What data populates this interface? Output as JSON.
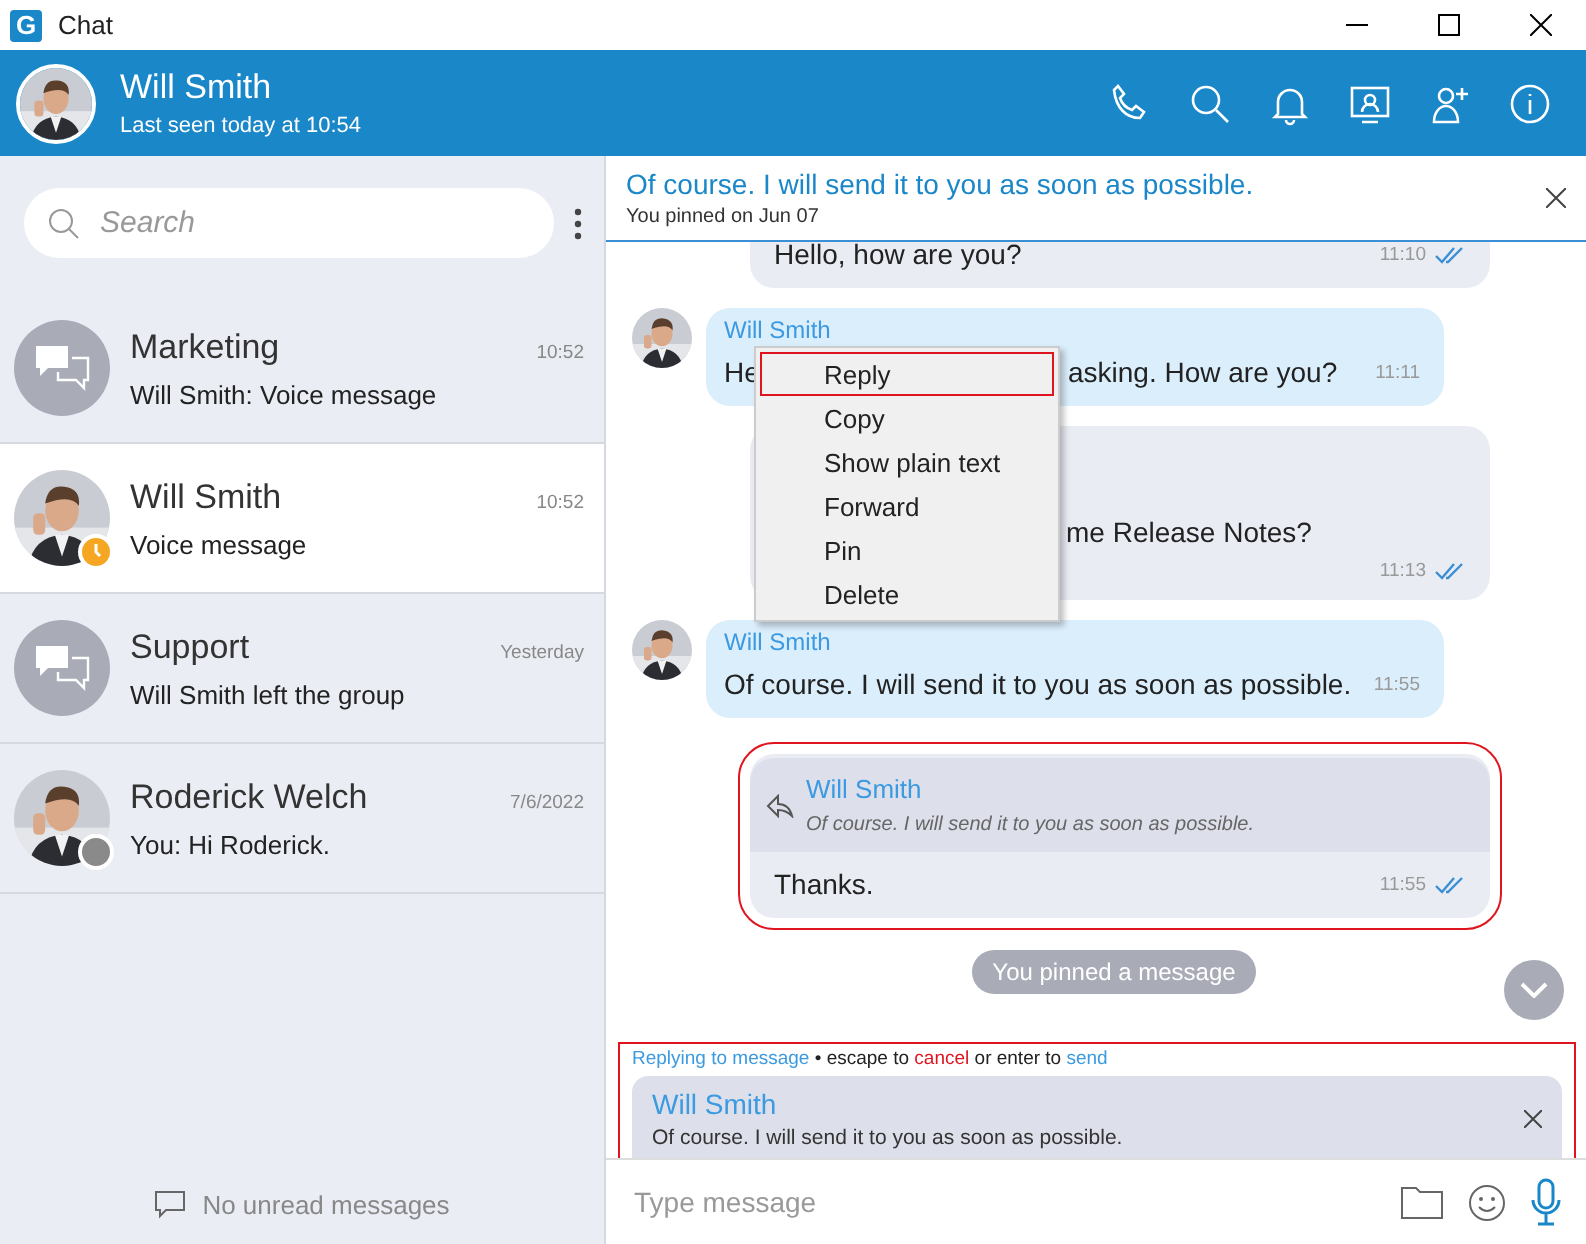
{
  "window": {
    "logo": "G",
    "title": "Chat"
  },
  "header": {
    "name": "Will Smith",
    "status": "Last seen today at 10:54"
  },
  "search": {
    "placeholder": "Search"
  },
  "chats": [
    {
      "kind": "group",
      "name": "Marketing",
      "time": "10:52",
      "preview": "Will Smith: Voice message",
      "selected": false
    },
    {
      "kind": "person",
      "name": "Will Smith",
      "time": "10:52",
      "preview": "Voice message",
      "selected": true,
      "away": true
    },
    {
      "kind": "group",
      "name": "Support",
      "time": "Yesterday",
      "preview": "Will Smith left the group",
      "selected": false
    },
    {
      "kind": "person",
      "name": "Roderick Welch",
      "time": "7/6/2022",
      "preview": "You: Hi Roderick.",
      "selected": false,
      "away": false
    }
  ],
  "sidebar_footer": "No unread messages",
  "pinned": {
    "text": "Of course. I will send it to you as soon as possible.",
    "note": "You pinned on Jun 07"
  },
  "messages": [
    {
      "kind": "outgoing",
      "text": "Hello, how are you?",
      "time": "11:10",
      "read": true,
      "highlighted": false
    },
    {
      "kind": "incoming",
      "sender": "Will Smith",
      "text_head": "He",
      "text_tail": "asking. How are you?",
      "time": "11:11",
      "highlighted": false
    },
    {
      "kind": "outgoing",
      "text_tail": "me Release Notes?",
      "time": "11:13",
      "read": true,
      "highlighted": false
    },
    {
      "kind": "incoming",
      "sender": "Will Smith",
      "text": "Of course. I will send it to you as soon as possible.",
      "time": "11:55",
      "highlighted": false
    },
    {
      "kind": "outgoing",
      "reply_to": {
        "sender": "Will Smith",
        "text": "Of course. I will send it to you as soon as possible."
      },
      "text": "Thanks.",
      "time": "11:55",
      "read": true,
      "highlighted": true
    }
  ],
  "system_notice": "You pinned a message",
  "context_menu": {
    "items": [
      {
        "label": "Reply",
        "highlighted": true
      },
      {
        "label": "Copy",
        "highlighted": false
      },
      {
        "label": "Show plain text",
        "highlighted": false
      },
      {
        "label": "Forward",
        "highlighted": false
      },
      {
        "label": "Pin",
        "highlighted": false
      },
      {
        "label": "Delete",
        "highlighted": false
      }
    ]
  },
  "reply_panel": {
    "highlighted": true,
    "hint": [
      {
        "kind": "accent",
        "text": "Replying to message"
      },
      {
        "kind": "plain",
        "text": " • escape to "
      },
      {
        "kind": "danger",
        "text": "cancel"
      },
      {
        "kind": "plain",
        "text": " or enter to "
      },
      {
        "kind": "accent",
        "text": "send"
      }
    ],
    "sender": "Will Smith",
    "text": "Of course. I will send it to you as soon as possible."
  },
  "composer": {
    "placeholder": "Type message"
  }
}
